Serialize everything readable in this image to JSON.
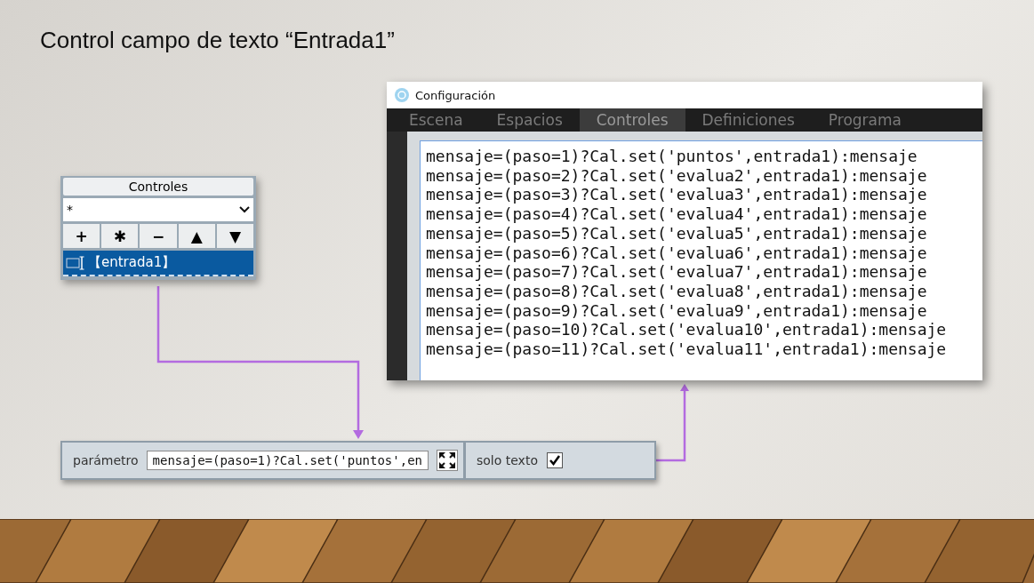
{
  "slide_title": "Control campo de texto “Entrada1”",
  "controls_panel": {
    "title": "Controles",
    "filter": "*",
    "buttons": [
      "+",
      "✱",
      "−",
      "▲",
      "▼"
    ],
    "items": [
      {
        "label": "【entrada1】",
        "selected": true
      }
    ]
  },
  "config_window": {
    "title": "Configuración",
    "tabs": [
      {
        "label": "Escena",
        "selected": false
      },
      {
        "label": "Espacios",
        "selected": false
      },
      {
        "label": "Controles",
        "selected": true
      },
      {
        "label": "Definiciones",
        "selected": false
      },
      {
        "label": "Programa",
        "selected": false
      }
    ],
    "editor_lines": [
      "mensaje=(paso=1)?Cal.set('puntos',entrada1):mensaje",
      "mensaje=(paso=2)?Cal.set('evalua2',entrada1):mensaje",
      "mensaje=(paso=3)?Cal.set('evalua3',entrada1):mensaje",
      "mensaje=(paso=4)?Cal.set('evalua4',entrada1):mensaje",
      "mensaje=(paso=5)?Cal.set('evalua5',entrada1):mensaje",
      "mensaje=(paso=6)?Cal.set('evalua6',entrada1):mensaje",
      "mensaje=(paso=7)?Cal.set('evalua7',entrada1):mensaje",
      "mensaje=(paso=8)?Cal.set('evalua8',entrada1):mensaje",
      "mensaje=(paso=9)?Cal.set('evalua9',entrada1):mensaje",
      "mensaje=(paso=10)?Cal.set('evalua10',entrada1):mensaje",
      "mensaje=(paso=11)?Cal.set('evalua11',entrada1):mensaje"
    ]
  },
  "parameter_bar": {
    "label": "parámetro",
    "value": "mensaje=(paso=1)?Cal.set('puntos',en",
    "solo_texto": {
      "label": "solo texto",
      "checked": true
    }
  }
}
